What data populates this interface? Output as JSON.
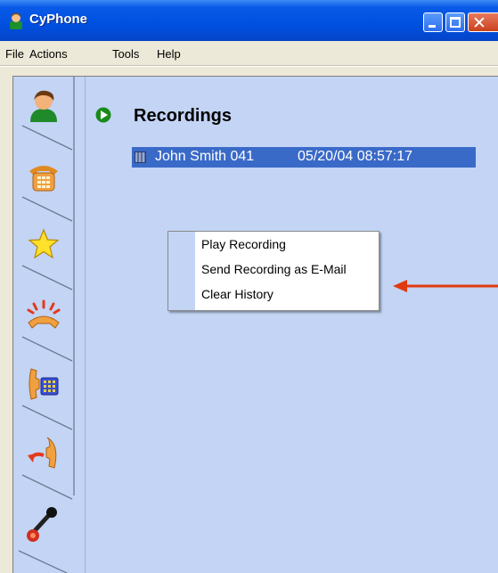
{
  "window": {
    "title": "CyPhone"
  },
  "menu": {
    "file": "File",
    "actions": "Actions",
    "tools": "Tools",
    "help": "Help"
  },
  "tabs": [
    {
      "icon": "contacts-icon"
    },
    {
      "icon": "dialpad-phone-icon"
    },
    {
      "icon": "favorites-star-icon"
    },
    {
      "icon": "ringing-phone-icon"
    },
    {
      "icon": "phone-keypad-icon"
    },
    {
      "icon": "call-back-icon"
    },
    {
      "icon": "microphone-icon",
      "active": true
    }
  ],
  "panel": {
    "title": "Recordings",
    "recordings": [
      {
        "name": "John Smith 041",
        "datetime": "05/20/04 08:57:17"
      }
    ]
  },
  "context_menu": {
    "items": [
      "Play Recording",
      "Send Recording as E-Mail",
      "Clear History"
    ]
  },
  "colors": {
    "titlebar": "#0050e0",
    "panel_bg": "#c3d4f5",
    "selection": "#3a6ac8",
    "annotation_arrow": "#e03a10"
  }
}
